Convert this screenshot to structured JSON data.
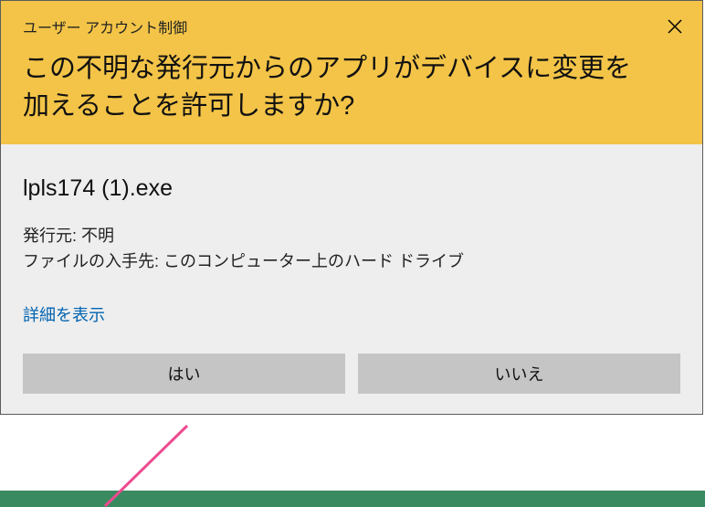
{
  "titlebar": "ユーザー アカウント制御",
  "question": "この不明な発行元からのアプリがデバイスに変更を加えることを許可しますか?",
  "app_name": "lpls174 (1).exe",
  "publisher_label": "発行元:",
  "publisher_value": "不明",
  "origin_label": "ファイルの入手先:",
  "origin_value": "このコンピューター上のハード ドライブ",
  "show_more": "詳細を表示",
  "buttons": {
    "yes": "はい",
    "no": "いいえ"
  }
}
